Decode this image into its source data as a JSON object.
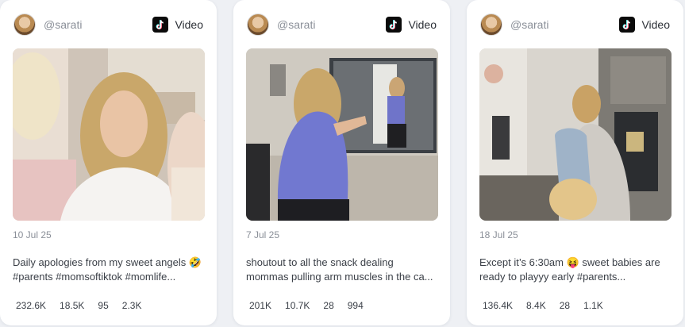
{
  "posts": [
    {
      "username": "@sarati",
      "platform_label": "Video",
      "platform_icon": "tiktok-icon",
      "date": "10 Jul 25",
      "caption_line1": "Daily apologies from my sweet angels 🤣",
      "caption_line2": "#parents #momsoftiktok #momlife...",
      "stats": [
        "232.6K",
        "18.5K",
        "95",
        "2.3K"
      ]
    },
    {
      "username": "@sarati",
      "platform_label": "Video",
      "platform_icon": "tiktok-icon",
      "date": "7 Jul 25",
      "caption_line1": "shoutout to all the snack dealing",
      "caption_line2": "mommas pulling arm muscles in the ca...",
      "stats": [
        "201K",
        "10.7K",
        "28",
        "994"
      ]
    },
    {
      "username": "@sarati",
      "platform_label": "Video",
      "platform_icon": "tiktok-icon",
      "date": "18 Jul 25",
      "caption_line1": "Except it’s 6:30am 😝 sweet babies are",
      "caption_line2": "ready to playyy early #parents...",
      "stats": [
        "136.4K",
        "8.4K",
        "28",
        "1.1K"
      ]
    }
  ]
}
